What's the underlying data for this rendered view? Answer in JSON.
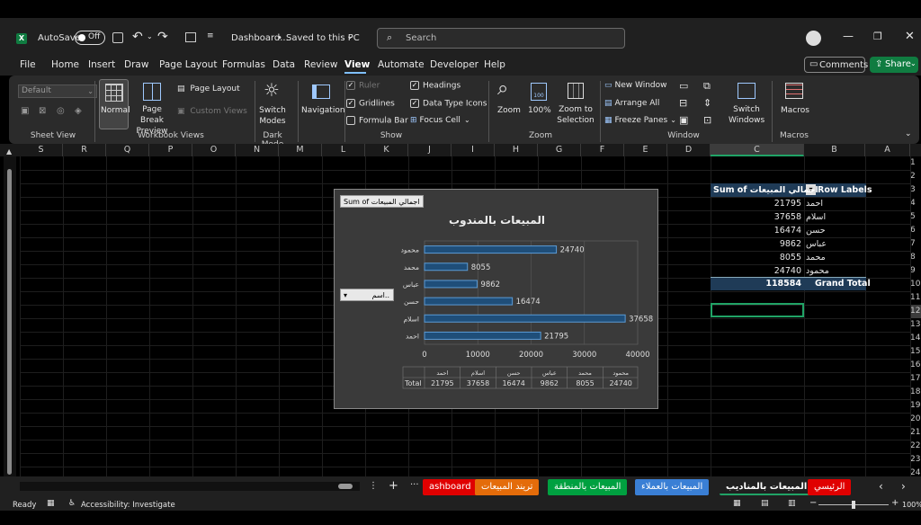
{
  "titlebar": {
    "autosave_label": "AutoSave",
    "autosave_state": "Off",
    "doc_title": "Dashboard...",
    "save_status": "Saved to this PC",
    "search_placeholder": "Search"
  },
  "menu": [
    "File",
    "Home",
    "Insert",
    "Draw",
    "Page Layout",
    "Formulas",
    "Data",
    "Review",
    "View",
    "Automate",
    "Developer",
    "Help"
  ],
  "menu_active": "View",
  "comments_label": "Comments",
  "share_label": "Share",
  "ribbon": {
    "sheet_view_default": "Default",
    "sheet_view_group": "Sheet View",
    "normal": "Normal",
    "page_break_preview": "Page Break Preview",
    "page_layout": "Page Layout",
    "custom_views": "Custom Views",
    "workbook_views_group": "Workbook Views",
    "switch_modes": "Switch Modes",
    "dark_mode_group": "Dark Mode",
    "navigation": "Navigation",
    "ruler": "Ruler",
    "gridlines": "Gridlines",
    "formula_bar": "Formula Bar",
    "headings": "Headings",
    "data_type_icons": "Data Type Icons",
    "focus_cell": "Focus Cell",
    "show_group": "Show",
    "zoom": "Zoom",
    "zoom100": "100%",
    "zoom_to_selection": "Zoom to Selection",
    "zoom_group": "Zoom",
    "new_window": "New Window",
    "arrange_all": "Arrange All",
    "freeze_panes": "Freeze Panes",
    "switch_windows": "Switch Windows",
    "window_group": "Window",
    "macros": "Macros",
    "macros_group": "Macros"
  },
  "columns": [
    "S",
    "R",
    "Q",
    "P",
    "O",
    "N",
    "M",
    "L",
    "K",
    "J",
    "I",
    "H",
    "G",
    "F",
    "E",
    "D",
    "C",
    "B",
    "A"
  ],
  "rows": [
    "1",
    "2",
    "3",
    "4",
    "5",
    "6",
    "7",
    "8",
    "9",
    "10",
    "11",
    "12",
    "13",
    "14",
    "15",
    "16",
    "17",
    "18",
    "19",
    "20",
    "21",
    "22",
    "23",
    "24"
  ],
  "pivot": {
    "header_labels": "Row Labels",
    "header_sum": "Sum of اجمالي المبيعات",
    "rows": [
      {
        "label": "احمد",
        "value": "21795"
      },
      {
        "label": "اسلام",
        "value": "37658"
      },
      {
        "label": "حسن",
        "value": "16474"
      },
      {
        "label": "عباس",
        "value": "9862"
      },
      {
        "label": "محمد",
        "value": "8055"
      },
      {
        "label": "محمود",
        "value": "24740"
      }
    ],
    "grand_total_label": "Grand Total",
    "grand_total_value": "118584"
  },
  "chart_field_button": "Sum of اجمالي المبيعات",
  "chart_axis_button": "اسم..",
  "chart_data": {
    "type": "bar",
    "orientation": "horizontal",
    "title": "المبيعات بالمندوب",
    "categories": [
      "احمد",
      "اسلام",
      "حسن",
      "عباس",
      "محمد",
      "محمود"
    ],
    "values": [
      21795,
      37658,
      16474,
      9862,
      8055,
      24740
    ],
    "xlim": [
      0,
      40000
    ],
    "xticks": [
      "0",
      "10000",
      "20000",
      "30000",
      "40000"
    ],
    "grid": true,
    "data_table_row_label": "Total",
    "bar_color": "#1f4e79"
  },
  "tabs": [
    {
      "label": "ashboard",
      "bg": "#e00000",
      "fg": "#ffffff"
    },
    {
      "label": "تريند المبيعات",
      "bg": "#e46c0a",
      "fg": "#ffffff"
    },
    {
      "label": "المبيعات بالمنطقة",
      "bg": "#00a040",
      "fg": "#ffffff"
    },
    {
      "label": "المبيعات بالعملاء",
      "bg": "#3a7fd5",
      "fg": "#ffffff"
    },
    {
      "label": "المبيعات بالمناديب",
      "bg": "#202020",
      "fg": "#ffffff"
    },
    {
      "label": "الرئيسي",
      "bg": "#e00000",
      "fg": "#ffffff"
    }
  ],
  "status": {
    "ready": "Ready",
    "accessibility": "Accessibility: Investigate",
    "zoom": "100%"
  },
  "colors": {
    "accent": "#185abd",
    "selection": "#21a366",
    "share": "#107c41"
  }
}
